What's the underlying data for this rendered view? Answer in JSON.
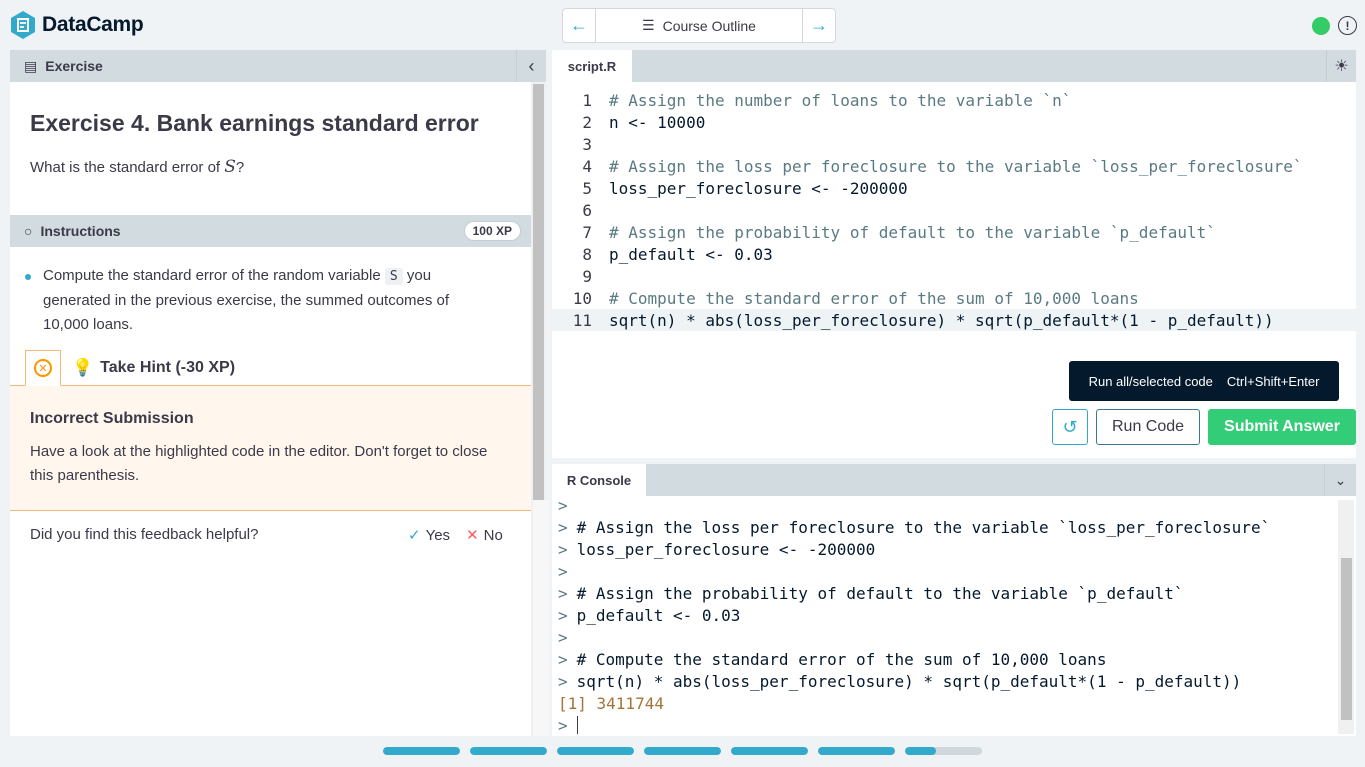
{
  "brand": {
    "name": "DataCamp"
  },
  "nav": {
    "label": "Course Outline"
  },
  "left": {
    "panel_title": "Exercise",
    "exercise_title": "Exercise 4. Bank earnings standard error",
    "question_prefix": "What is the standard error of ",
    "question_var": "S",
    "question_suffix": "?",
    "instructions_label": "Instructions",
    "xp_badge": "100 XP",
    "instruction_text_1": "Compute the standard error of the random variable ",
    "instruction_code": "S",
    "instruction_text_2": " you generated in the previous exercise, the summed outcomes of 10,000 loans.",
    "hint_label": "Take Hint (-30 XP)",
    "feedback_title": "Incorrect Submission",
    "feedback_text": "Have a look at the highlighted code in the editor. Don't forget to close this parenthesis.",
    "helpful_question": "Did you find this feedback helpful?",
    "yes_label": "Yes",
    "no_label": "No"
  },
  "editor": {
    "file_tab": "script.R",
    "lines": [
      {
        "n": "1",
        "text": "# Assign the number of loans to the variable `n`"
      },
      {
        "n": "2",
        "text": "n <- 10000"
      },
      {
        "n": "3",
        "text": ""
      },
      {
        "n": "4",
        "text": "# Assign the loss per foreclosure to the variable `loss_per_foreclosure`"
      },
      {
        "n": "5",
        "text": "loss_per_foreclosure <- -200000"
      },
      {
        "n": "6",
        "text": ""
      },
      {
        "n": "7",
        "text": "# Assign the probability of default to the variable `p_default`"
      },
      {
        "n": "8",
        "text": "p_default <- 0.03"
      },
      {
        "n": "9",
        "text": ""
      },
      {
        "n": "10",
        "text": "# Compute the standard error of the sum of 10,000 loans"
      },
      {
        "n": "11",
        "text": "sqrt(n) * abs(loss_per_foreclosure) * sqrt(p_default*(1 - p_default))"
      }
    ],
    "tooltip_label": "Run all/selected code",
    "tooltip_shortcut": "Ctrl+Shift+Enter",
    "run_label": "Run Code",
    "submit_label": "Submit Answer"
  },
  "console": {
    "tab": "R Console",
    "lines": [
      {
        "prompt": ">",
        "text": ""
      },
      {
        "prompt": ">",
        "text": "# Assign the loss per foreclosure to the variable `loss_per_foreclosure`"
      },
      {
        "prompt": ">",
        "text": "loss_per_foreclosure <- -200000"
      },
      {
        "prompt": ">",
        "text": ""
      },
      {
        "prompt": ">",
        "text": "# Assign the probability of default to the variable `p_default`"
      },
      {
        "prompt": ">",
        "text": "p_default <- 0.03"
      },
      {
        "prompt": ">",
        "text": ""
      },
      {
        "prompt": ">",
        "text": "# Compute the standard error of the sum of 10,000 loans"
      },
      {
        "prompt": ">",
        "text": "sqrt(n) * abs(loss_per_foreclosure) * sqrt(p_default*(1 - p_default))"
      }
    ],
    "output": "[1] 3411744",
    "input_prompt": ">"
  },
  "progress": {
    "segments": 7,
    "completed": 6,
    "current_fraction": 0.4
  },
  "colors": {
    "accent": "#33aacc",
    "success": "#33cc77",
    "warning": "#ff9400",
    "ink": "#05192d"
  }
}
